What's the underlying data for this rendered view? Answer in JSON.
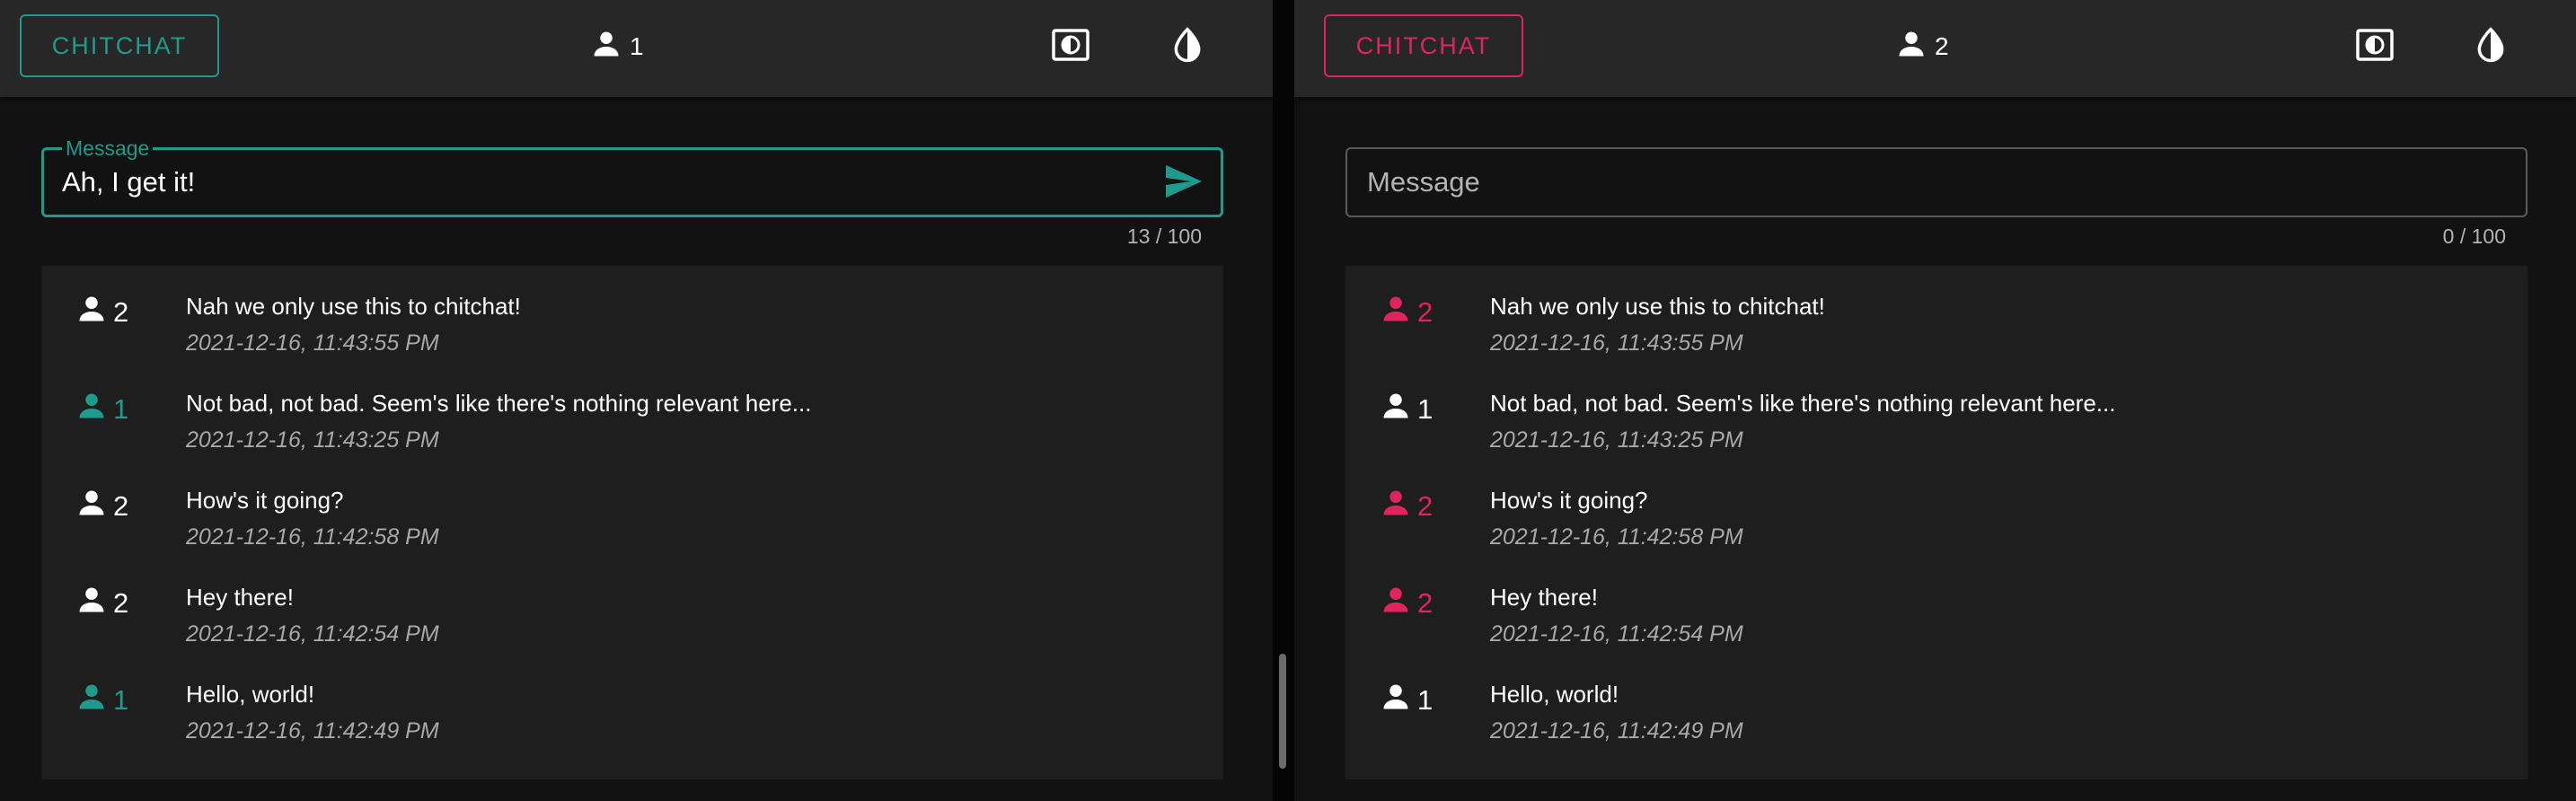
{
  "colors": {
    "left_accent": "#1e9b8d",
    "right_accent": "#e0245e",
    "background": "#121212",
    "appbar": "#272727",
    "list_background": "#1e1e1e"
  },
  "left": {
    "brand_label": "CHITCHAT",
    "user_count": "1",
    "display_icon": "display-settings-icon",
    "contrast_icon": "contrast-icon",
    "message_field": {
      "label": "Message",
      "value": "Ah, I get it!",
      "counter": "13 / 100"
    },
    "messages": [
      {
        "user": "2",
        "own": false,
        "text": "Nah we only use this to chitchat!",
        "time": "2021-12-16, 11:43:55 PM"
      },
      {
        "user": "1",
        "own": true,
        "text": "Not bad, not bad. Seem's like there's nothing relevant here...",
        "time": "2021-12-16, 11:43:25 PM"
      },
      {
        "user": "2",
        "own": false,
        "text": "How's it going?",
        "time": "2021-12-16, 11:42:58 PM"
      },
      {
        "user": "2",
        "own": false,
        "text": "Hey there!",
        "time": "2021-12-16, 11:42:54 PM"
      },
      {
        "user": "1",
        "own": true,
        "text": "Hello, world!",
        "time": "2021-12-16, 11:42:49 PM"
      }
    ]
  },
  "right": {
    "brand_label": "CHITCHAT",
    "user_count": "2",
    "display_icon": "display-settings-icon",
    "contrast_icon": "contrast-icon",
    "message_field": {
      "placeholder": "Message",
      "value": "",
      "counter": "0 / 100"
    },
    "messages": [
      {
        "user": "2",
        "own": true,
        "text": "Nah we only use this to chitchat!",
        "time": "2021-12-16, 11:43:55 PM"
      },
      {
        "user": "1",
        "own": false,
        "text": "Not bad, not bad. Seem's like there's nothing relevant here...",
        "time": "2021-12-16, 11:43:25 PM"
      },
      {
        "user": "2",
        "own": true,
        "text": "How's it going?",
        "time": "2021-12-16, 11:42:58 PM"
      },
      {
        "user": "2",
        "own": true,
        "text": "Hey there!",
        "time": "2021-12-16, 11:42:54 PM"
      },
      {
        "user": "1",
        "own": false,
        "text": "Hello, world!",
        "time": "2021-12-16, 11:42:49 PM"
      }
    ]
  }
}
